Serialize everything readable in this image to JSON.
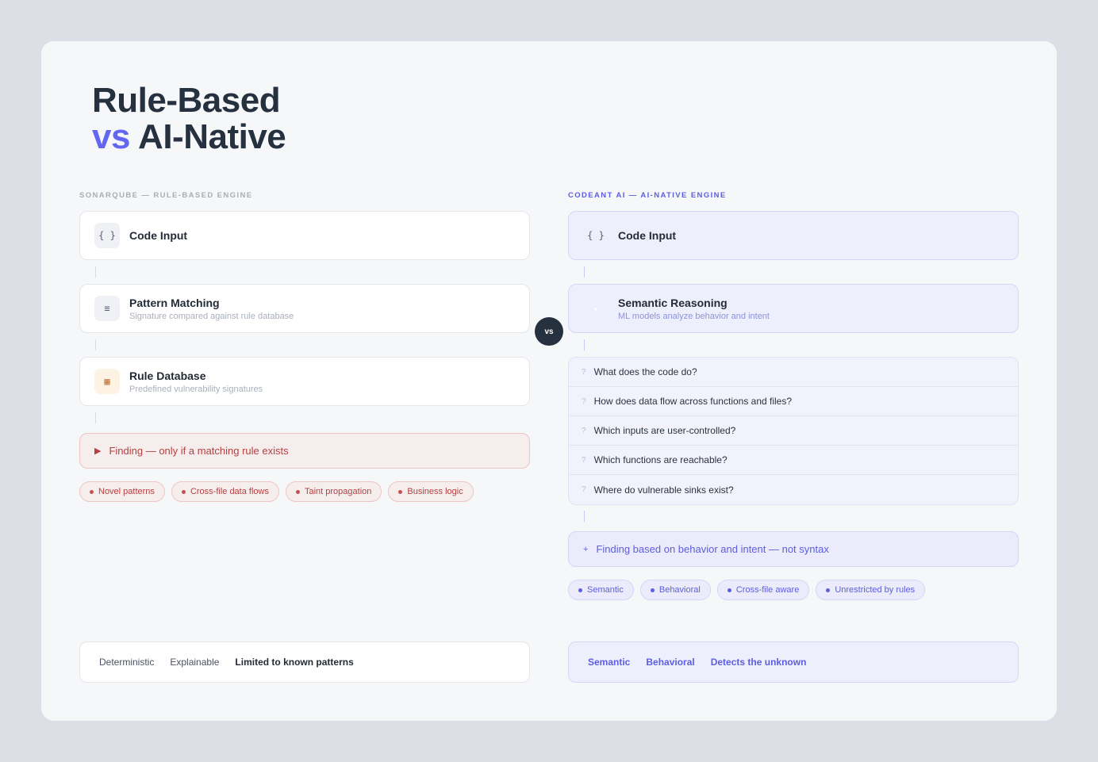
{
  "title": {
    "line1": "Rule-Based",
    "vs": "vs",
    "line2": "AI-Native"
  },
  "vs_badge": "vs",
  "left": {
    "eyebrow": "SONARQUBE — RULE-BASED ENGINE",
    "nodes": [
      {
        "icon": "{ }",
        "title": "Code Input",
        "subtitle": ""
      },
      {
        "icon": "≡",
        "title": "Pattern Matching",
        "subtitle": "Signature compared against rule database"
      },
      {
        "icon": "▦",
        "title": "Rule Database",
        "subtitle": "Predefined vulnerability signatures"
      }
    ],
    "finding_icon": "▶",
    "finding": "Finding — only if a matching rule exists",
    "chips": [
      "Novel patterns",
      "Cross-file data flows",
      "Taint propagation",
      "Business logic"
    ],
    "footer": [
      "Deterministic",
      "Explainable",
      "Limited to known patterns"
    ]
  },
  "right": {
    "eyebrow": "CODEANT AI — AI-NATIVE ENGINE",
    "nodes": [
      {
        "icon": "{ }",
        "title": "Code Input",
        "subtitle": ""
      },
      {
        "icon": "✦",
        "title": "Semantic Reasoning",
        "subtitle": "ML models analyze behavior and intent"
      }
    ],
    "question_icon": "?",
    "questions": [
      "What does the code do?",
      "How does data flow across functions and files?",
      "Which inputs are user-controlled?",
      "Which functions are reachable?",
      "Where do vulnerable sinks exist?"
    ],
    "finding_icon": "+",
    "finding": "Finding based on behavior and intent — not syntax",
    "chips": [
      "Semantic",
      "Behavioral",
      "Cross-file aware",
      "Unrestricted by rules"
    ],
    "footer": [
      "Semantic",
      "Behavioral",
      "Detects the unknown"
    ]
  },
  "colors": {
    "accent": "#6366f1",
    "danger": "#b54040",
    "dark": "#263140"
  }
}
